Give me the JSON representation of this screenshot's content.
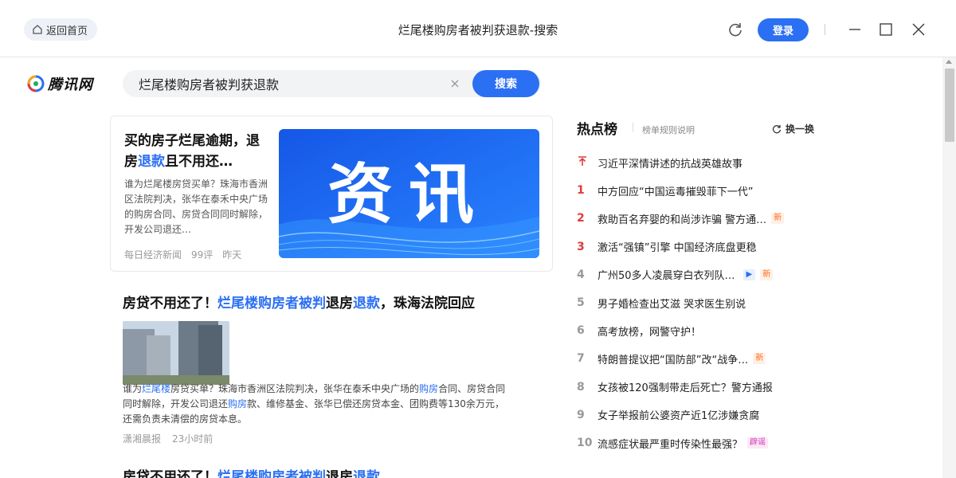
{
  "titlebar": {
    "home_label": "返回首页",
    "title": "烂尾楼购房者被判获退款-搜索",
    "login_label": "登录"
  },
  "header": {
    "logo_text": "腾讯网",
    "search_value": "烂尾楼购房者被判获退款",
    "search_button": "搜索"
  },
  "featured": {
    "title_a": "买的房子烂尾逾期，退房",
    "title_hl": "退款",
    "title_b": "且不用还…",
    "desc": "谁为烂尾楼房贷买单？珠海市香洲区法院判决，张华在泰禾中央广场的购房合同、房贷合同同时解除，开发公司退还…",
    "source": "每日经济新闻",
    "comments": "99评",
    "time": "昨天",
    "banner_text": "资讯"
  },
  "results": [
    {
      "title_a": "房贷不用还了！",
      "title_hl1": "烂尾楼购房者被判",
      "title_b": "退房",
      "title_hl2": "退款",
      "title_c": "，珠海法院回应",
      "desc_a": "谁为",
      "desc_hl1": "烂尾楼",
      "desc_b": "房贷买单？珠海市香洲区法院判决，张华在泰禾中央广场的",
      "desc_hl2": "购房",
      "desc_c": "合同、房贷合同同时解除，开发公司退还",
      "desc_hl3": "购房",
      "desc_d": "款、维修基金、张华已偿还房贷本金、团购费等130余万元，还需负责未清偿的房贷本息。",
      "source": "潇湘晨报",
      "time": "23小时前"
    },
    {
      "title_a": "房贷不用还了！",
      "title_hl1": "烂尾楼购房者被判",
      "title_b": "退房",
      "title_hl2": "退款"
    }
  ],
  "hotlist": {
    "title": "热点榜",
    "rule_label": "榜单规则说明",
    "refresh_label": "换一换",
    "items": [
      {
        "rank": "",
        "text": "习近平深情讲述的抗战英雄故事",
        "tag": ""
      },
      {
        "rank": "1",
        "text": "中方回应“中国运毒摧毁菲下一代”",
        "tag": ""
      },
      {
        "rank": "2",
        "text": "救助百名弃婴的和尚涉诈骗 警方通…",
        "tag": "新"
      },
      {
        "rank": "3",
        "text": "激活“强镇”引擎 中国经济底盘更稳",
        "tag": ""
      },
      {
        "rank": "4",
        "text": "广州50多人凌晨穿白衣列队…",
        "tag": "新",
        "video": "▶"
      },
      {
        "rank": "5",
        "text": "男子婚检查出艾滋 哭求医生别说",
        "tag": ""
      },
      {
        "rank": "6",
        "text": "高考放榜，网警守护！",
        "tag": ""
      },
      {
        "rank": "7",
        "text": "特朗普提议把“国防部”改“战争…",
        "tag": "新"
      },
      {
        "rank": "8",
        "text": "女孩被120强制带走后死亡？警方通报",
        "tag": ""
      },
      {
        "rank": "9",
        "text": "女子举报前公婆资产近1亿涉嫌贪腐",
        "tag": ""
      },
      {
        "rank": "10",
        "text": "流感症状最严重时传染性最强？",
        "tag": "辟谣"
      }
    ]
  },
  "colors": {
    "accent": "#2b6ff2",
    "rank_red": "#e33b3b",
    "tag_new": "#ff6b1a"
  }
}
